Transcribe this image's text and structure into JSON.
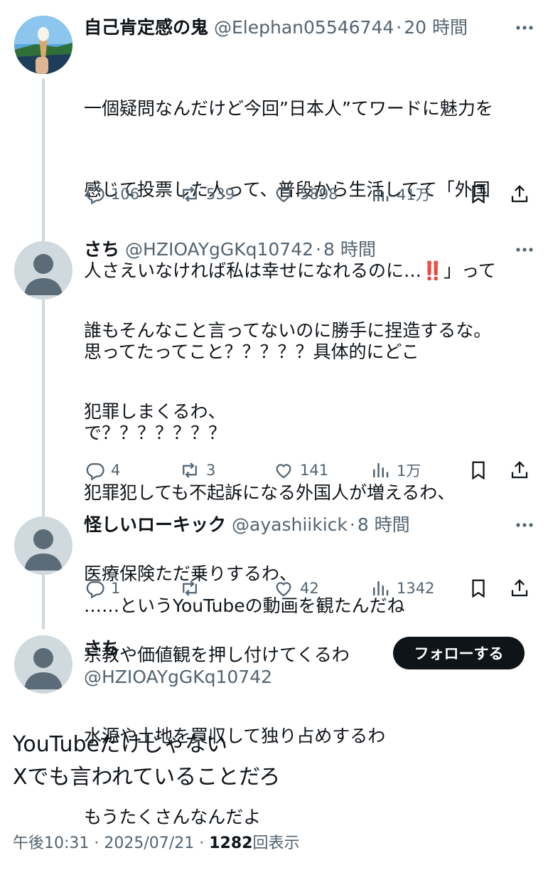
{
  "posts": [
    {
      "name": "自己肯定感の鬼",
      "handle": "@Elephan05546744",
      "time": "20 時間",
      "text_lines": [
        "一個疑問なんだけど今回”日本人”てワードに魅力を",
        "感じて投票した人って、普段から生活してて「外国",
        "人さえいなければ私は幸せになれるのに…‼️」って",
        "思ってたってこと？？？？？具体的にどこ",
        "で？？？？？？？"
      ],
      "replies": "106",
      "reposts": "539",
      "likes": "5898",
      "views": "41万"
    },
    {
      "name": "さち",
      "handle": "@HZIOAYgGKq10742",
      "time": "8 時間",
      "text_lines": [
        "誰もそんなこと言ってないのに勝手に捏造するな。",
        "犯罪しまくるわ、",
        "犯罪犯しても不起訴になる外国人が増えるわ、",
        "医療保険ただ乗りするわ、",
        "宗教や価値観を押し付けてくるわ",
        "水源や土地を買収して独り占めするわ",
        "もうたくさんなんだよ"
      ],
      "replies": "4",
      "reposts": "3",
      "likes": "141",
      "views": "1万"
    },
    {
      "name": "怪しいローキック",
      "handle": "@ayashiikick",
      "time": "8 時間",
      "text_lines": [
        "……というYouTubeの動画を観たんだね"
      ],
      "replies": "1",
      "reposts": "",
      "likes": "42",
      "views": "1342"
    }
  ],
  "main": {
    "name": "さち",
    "handle": "@HZIOAYgGKq10742",
    "follow_label": "フォローする",
    "text_lines": [
      "YouTubeだけじゃない",
      "Xでも言われていることだろ"
    ],
    "time": "午後10:31",
    "date": "2025/07/21",
    "views": "1282",
    "views_label": "回表示"
  },
  "separator": "·",
  "icons": {
    "more": "more-horizontal-icon",
    "reply": "reply-icon",
    "repost": "repost-icon",
    "like": "heart-icon",
    "views": "views-chart-icon",
    "bookmark": "bookmark-icon",
    "share": "share-icon"
  },
  "colors": {
    "text": "#0f1419",
    "secondary": "#536471",
    "line": "#cfd9de",
    "button": "#0f1419"
  }
}
